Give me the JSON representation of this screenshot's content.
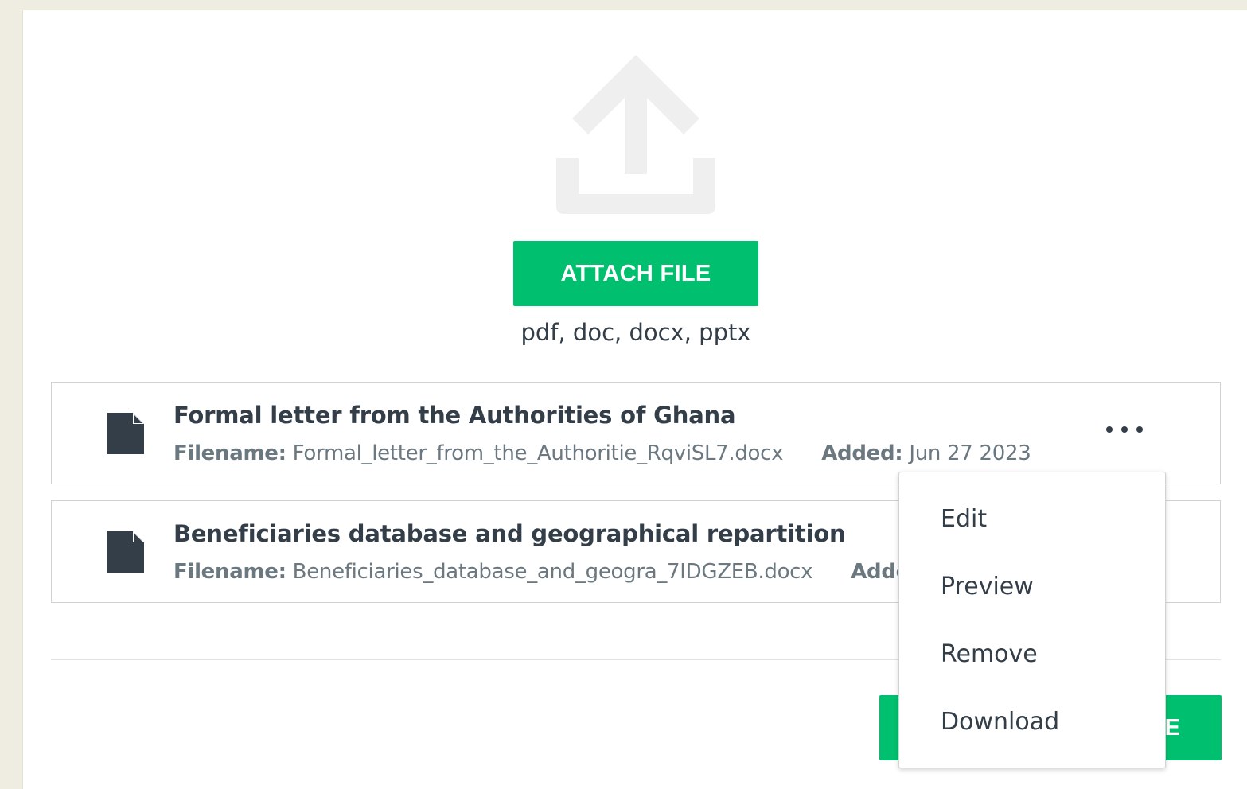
{
  "upload": {
    "icon": "upload-icon",
    "attach_label": "ATTACH FILE",
    "formats": "pdf, doc, docx, pptx"
  },
  "files": [
    {
      "icon": "file-icon",
      "title": "Formal letter from the Authorities of Ghana",
      "filename_label": "Filename:",
      "filename": "Formal_letter_from_the_Authoritie_RqviSL7.docx",
      "added_label": "Added:",
      "added": "Jun 27 2023"
    },
    {
      "icon": "file-icon",
      "title": "Beneficiaries database and geographical repartition",
      "filename_label": "Filename:",
      "filename": "Beneficiaries_database_and_geogra_7IDGZEB.docx",
      "added_label": "Added:",
      "added": ""
    }
  ],
  "menu": {
    "items": [
      "Edit",
      "Preview",
      "Remove",
      "Download"
    ]
  },
  "footer": {
    "save_label": "SAVE"
  },
  "colors": {
    "accent": "#00bf6f",
    "text": "#333e48",
    "muted": "#6b787f",
    "page_bg": "#efede1"
  }
}
